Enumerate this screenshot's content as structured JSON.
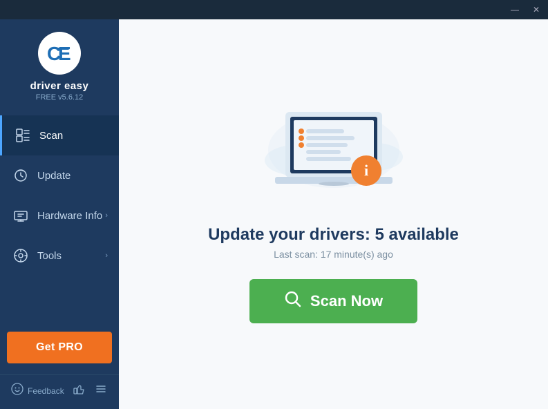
{
  "titlebar": {
    "minimize_label": "—",
    "close_label": "✕"
  },
  "sidebar": {
    "logo": {
      "letters": "CE",
      "app_name": "driver easy",
      "version": "FREE v5.6.12"
    },
    "nav_items": [
      {
        "id": "scan",
        "label": "Scan",
        "active": true,
        "has_chevron": false
      },
      {
        "id": "update",
        "label": "Update",
        "active": false,
        "has_chevron": false
      },
      {
        "id": "hardware-info",
        "label": "Hardware Info",
        "active": false,
        "has_chevron": true
      },
      {
        "id": "tools",
        "label": "Tools",
        "active": false,
        "has_chevron": true
      }
    ],
    "get_pro_label": "Get PRO",
    "footer": {
      "feedback_label": "Feedback"
    }
  },
  "main": {
    "heading": "Update your drivers: 5 available",
    "sub_text": "Last scan: 17 minute(s) ago",
    "scan_button_label": "Scan Now"
  },
  "colors": {
    "sidebar_bg": "#1e3a5f",
    "active_nav": "#163354",
    "accent_blue": "#1e6eb5",
    "orange": "#f07020",
    "green": "#4caf50",
    "info_orange": "#f08030"
  }
}
